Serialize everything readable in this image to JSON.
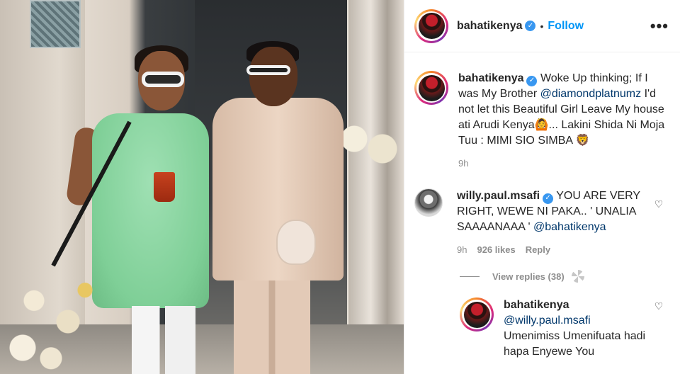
{
  "post": {
    "username": "bahatikenya",
    "follow_label": "Follow",
    "separator": "•",
    "more_label": "•••"
  },
  "caption": {
    "username": "bahatikenya",
    "text_before": "Woke Up thinking; If I was My Brother ",
    "mention": "@diamondplatnumz",
    "text_after": " I'd not let this Beautiful Girl Leave My house ati Arudi Kenya🙆... Lakini Shida Ni Moja Tuu : MIMI SIO SIMBA 🦁",
    "time": "9h"
  },
  "comments": [
    {
      "username": "willy.paul.msafi",
      "text": "YOU ARE VERY RIGHT, WEWE NI PAKA.. ' UNALIA SAAAANAAA ' ",
      "mention": "@bahatikenya",
      "time": "9h",
      "likes": "926 likes",
      "reply_label": "Reply",
      "view_replies": "View replies (38)"
    }
  ],
  "reply": {
    "username": "bahatikenya",
    "mention": "@willy.paul.msafi",
    "text": "Umenimiss Umenifuata hadi hapa Enyewe You"
  },
  "icons": {
    "verified": "✓",
    "heart": "♡"
  },
  "colors": {
    "follow": "#0095f6",
    "verified": "#3897f0",
    "mention": "#00376b",
    "muted": "#8e8e8e"
  }
}
